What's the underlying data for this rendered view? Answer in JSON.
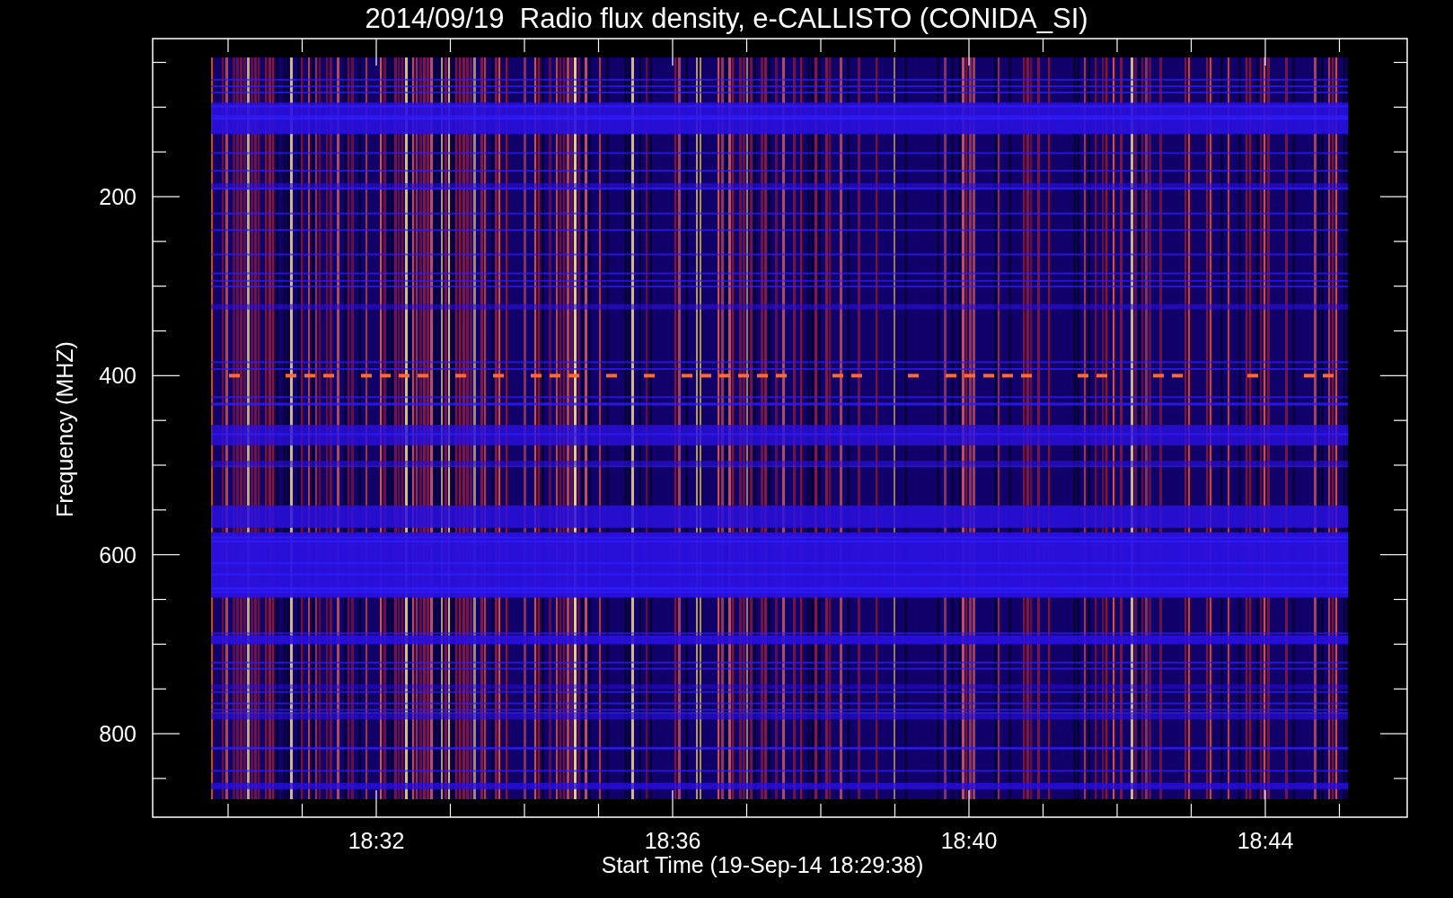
{
  "title": "2014/09/19  Radio flux density, e-CALLISTO (CONIDA_SI)",
  "plot": {
    "ylabel": "Frequency (MHZ)",
    "xlabel": "Start Time (19-Sep-14 18:29:38)",
    "yticks": [
      "200",
      "400",
      "600",
      "800"
    ],
    "xticks": [
      "18:32",
      "18:36",
      "18:40",
      "18:44"
    ]
  }
}
